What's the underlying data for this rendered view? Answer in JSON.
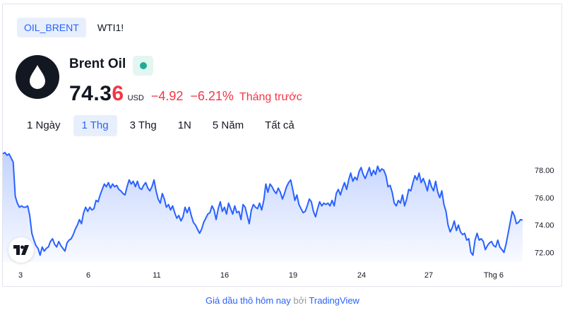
{
  "symbol_tabs": [
    {
      "label": "OIL_BRENT",
      "active": true
    },
    {
      "label": "WTI1!",
      "active": false
    }
  ],
  "instrument": {
    "name": "Brent Oil",
    "logo_icon": "oil-drop-icon",
    "market_status": "open",
    "price_main": "74.3",
    "price_last_digit": "6",
    "currency": "USD",
    "change": "−4.92",
    "change_percent": "−6.21%",
    "period": "Tháng trước"
  },
  "range_tabs": [
    {
      "label": "1 Ngày",
      "active": false
    },
    {
      "label": "1 Thg",
      "active": true
    },
    {
      "label": "3 Thg",
      "active": false
    },
    {
      "label": "1N",
      "active": false
    },
    {
      "label": "5 Năm",
      "active": false
    },
    {
      "label": "Tất cả",
      "active": false
    }
  ],
  "footer": {
    "link_text": "Giá dầu thô hôm nay",
    "by_text": "bởi",
    "provider": "TradingView"
  },
  "colors": {
    "line": "#2962ff",
    "down": "#f23645",
    "accent": "#2962ff",
    "status": "#22ab94"
  },
  "chart_data": {
    "type": "area",
    "x_ticks": [
      "3",
      "6",
      "11",
      "16",
      "19",
      "24",
      "27",
      "Thg 6"
    ],
    "y_ticks": [
      "72.00",
      "74.00",
      "76.00",
      "78.00"
    ],
    "ylim": [
      71.3,
      79.5
    ],
    "series": [
      {
        "values": [
          79.2,
          79.3,
          79.1,
          79.2,
          78.9,
          78.6,
          76.1,
          75.6,
          75.3,
          75.4,
          75.3,
          75.3,
          75.4,
          74.7,
          73.4,
          72.9,
          72.5,
          72.3,
          71.8,
          72.4,
          72.1,
          72.3,
          72.4,
          72.8,
          73.0,
          72.6,
          72.4,
          72.8,
          72.5,
          72.3,
          72.1,
          72.7,
          72.9,
          73.0,
          73.3,
          73.7,
          74.0,
          74.4,
          74.1,
          74.9,
          75.3,
          75.0,
          75.3,
          75.1,
          75.2,
          75.8,
          75.7,
          76.2,
          76.6,
          77.0,
          76.8,
          77.1,
          76.7,
          77.0,
          76.8,
          76.9,
          76.6,
          76.5,
          76.3,
          76.2,
          76.8,
          77.3,
          77.0,
          77.2,
          76.8,
          77.2,
          76.7,
          76.6,
          76.9,
          77.1,
          76.7,
          76.5,
          76.8,
          77.3,
          76.5,
          75.9,
          75.6,
          76.3,
          75.9,
          75.3,
          75.5,
          75.1,
          75.4,
          74.9,
          74.5,
          74.7,
          74.3,
          74.6,
          75.3,
          74.9,
          75.3,
          74.7,
          74.2,
          74.0,
          73.7,
          73.4,
          73.7,
          74.2,
          74.5,
          74.8,
          74.9,
          75.4,
          75.1,
          74.4,
          75.2,
          75.7,
          75.0,
          75.3,
          74.8,
          75.6,
          75.2,
          74.8,
          75.4,
          74.9,
          75.0,
          74.4,
          75.5,
          75.3,
          74.7,
          74.1,
          75.1,
          75.5,
          75.3,
          75.2,
          75.6,
          75.1,
          75.8,
          77.0,
          76.4,
          77.0,
          76.8,
          76.5,
          76.3,
          76.7,
          76.4,
          75.9,
          76.3,
          76.8,
          77.1,
          77.3,
          76.6,
          75.8,
          76.2,
          75.5,
          75.2,
          74.9,
          75.0,
          75.4,
          75.9,
          75.7,
          75.0,
          74.6,
          75.2,
          75.7,
          75.4,
          75.6,
          75.5,
          75.6,
          75.4,
          75.8,
          75.4,
          76.3,
          76.6,
          76.2,
          76.7,
          77.1,
          76.6,
          77.3,
          77.8,
          77.2,
          77.5,
          77.3,
          77.9,
          78.2,
          77.7,
          77.4,
          77.8,
          78.2,
          77.6,
          78.0,
          77.7,
          78.3,
          77.9,
          78.1,
          78.0,
          77.6,
          76.8,
          76.9,
          76.4,
          75.6,
          75.4,
          75.8,
          75.6,
          76.2,
          75.4,
          75.9,
          76.6,
          76.5,
          77.1,
          77.6,
          77.3,
          77.8,
          77.1,
          77.4,
          77.0,
          76.5,
          77.3,
          76.8,
          76.5,
          77.2,
          76.4,
          76.0,
          76.5,
          75.5,
          75.0,
          74.0,
          73.5,
          73.8,
          74.3,
          73.6,
          74.0,
          73.5,
          73.3,
          73.4,
          72.9,
          73.0,
          72.0,
          71.8,
          72.9,
          73.4,
          72.9,
          73.0,
          72.8,
          72.2,
          72.5,
          72.7,
          72.8,
          72.5,
          72.4,
          72.9,
          72.4,
          72.2,
          72.0,
          72.6,
          73.4,
          74.2,
          75.0,
          74.7,
          74.1,
          74.2,
          74.4,
          74.36
        ]
      }
    ]
  }
}
